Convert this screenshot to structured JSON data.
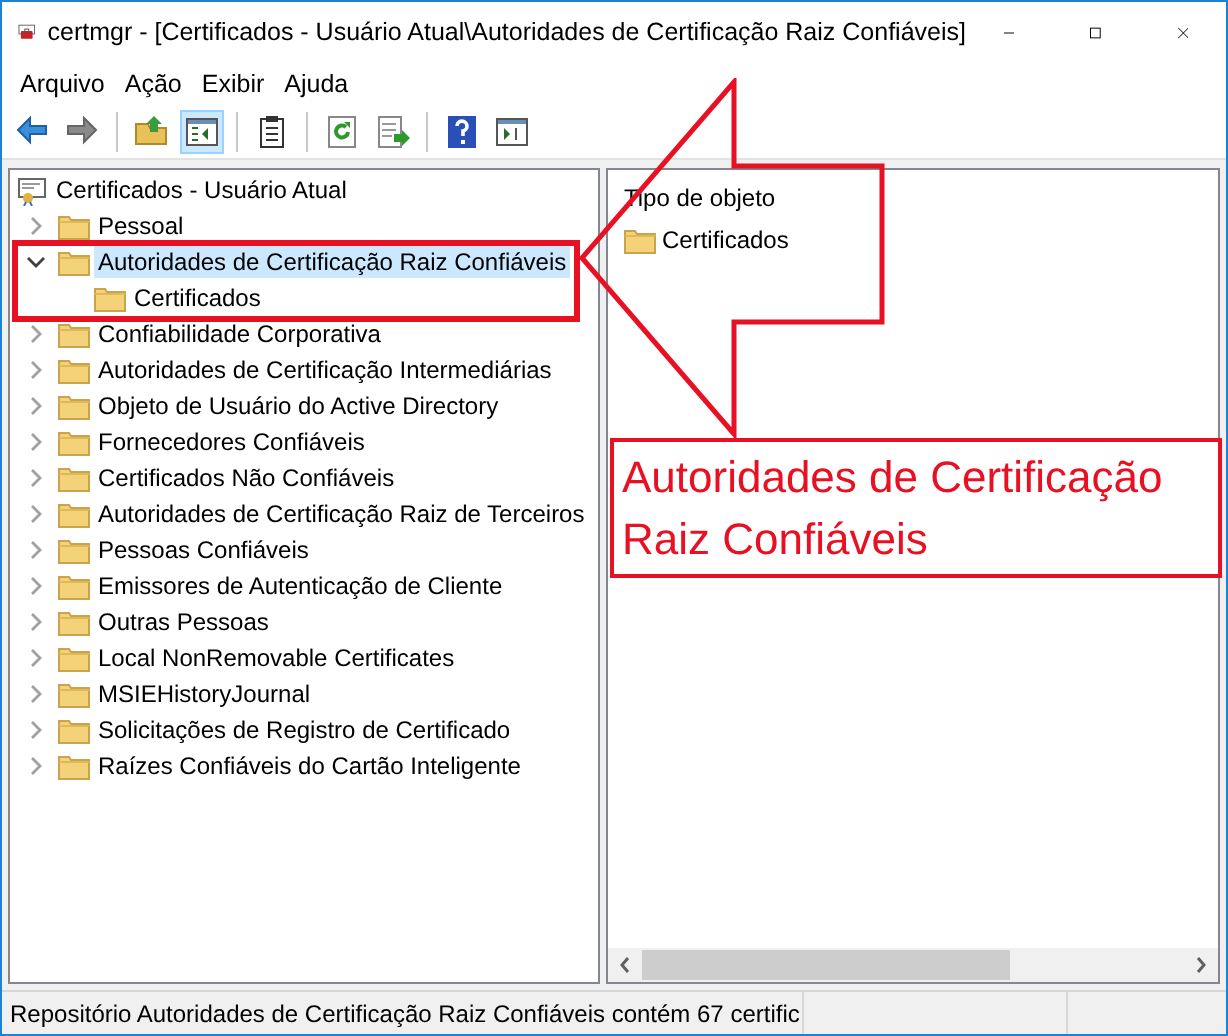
{
  "window": {
    "title": "certmgr - [Certificados - Usuário Atual\\Autoridades de Certificação Raiz Confiáveis]"
  },
  "menu": [
    "Arquivo",
    "Ação",
    "Exibir",
    "Ajuda"
  ],
  "toolbar": [
    {
      "kind": "back",
      "selected": false
    },
    {
      "kind": "forward",
      "selected": false
    },
    {
      "kind": "sep"
    },
    {
      "kind": "up",
      "selected": false
    },
    {
      "kind": "tree",
      "selected": true
    },
    {
      "kind": "sep"
    },
    {
      "kind": "clipboard",
      "selected": false
    },
    {
      "kind": "sep"
    },
    {
      "kind": "refresh",
      "selected": false
    },
    {
      "kind": "export",
      "selected": false
    },
    {
      "kind": "sep"
    },
    {
      "kind": "help",
      "selected": false
    },
    {
      "kind": "panel",
      "selected": false
    }
  ],
  "tree": {
    "label": "Certificados - Usuário Atual",
    "children": [
      {
        "label": "Pessoal",
        "expanded": false,
        "selected": false
      },
      {
        "label": "Autoridades de Certificação Raiz Confiáveis",
        "expanded": true,
        "selected": true,
        "children": [
          {
            "label": "Certificados",
            "selected": false
          }
        ]
      },
      {
        "label": "Confiabilidade Corporativa",
        "expanded": false,
        "selected": false
      },
      {
        "label": "Autoridades de Certificação Intermediárias",
        "expanded": false,
        "selected": false
      },
      {
        "label": "Objeto de Usuário do Active Directory",
        "expanded": false,
        "selected": false
      },
      {
        "label": "Fornecedores Confiáveis",
        "expanded": false,
        "selected": false
      },
      {
        "label": "Certificados Não Confiáveis",
        "expanded": false,
        "selected": false
      },
      {
        "label": "Autoridades de Certificação Raiz de Terceiros",
        "expanded": false,
        "selected": false
      },
      {
        "label": "Pessoas Confiáveis",
        "expanded": false,
        "selected": false
      },
      {
        "label": "Emissores de Autenticação de Cliente",
        "expanded": false,
        "selected": false
      },
      {
        "label": "Outras Pessoas",
        "expanded": false,
        "selected": false
      },
      {
        "label": "Local NonRemovable Certificates",
        "expanded": false,
        "selected": false
      },
      {
        "label": "MSIEHistoryJournal",
        "expanded": false,
        "selected": false
      },
      {
        "label": "Solicitações de Registro de Certificado",
        "expanded": false,
        "selected": false
      },
      {
        "label": "Raízes Confiáveis do Cartão Inteligente",
        "expanded": false,
        "selected": false
      }
    ]
  },
  "list": {
    "column": "Tipo de objeto",
    "items": [
      "Certificados"
    ]
  },
  "callout": {
    "text": "Autoridades de Certificação Raiz Confiáveis"
  },
  "status_bar": "Repositório Autoridades de Certificação Raiz Confiáveis contém 67 certific"
}
